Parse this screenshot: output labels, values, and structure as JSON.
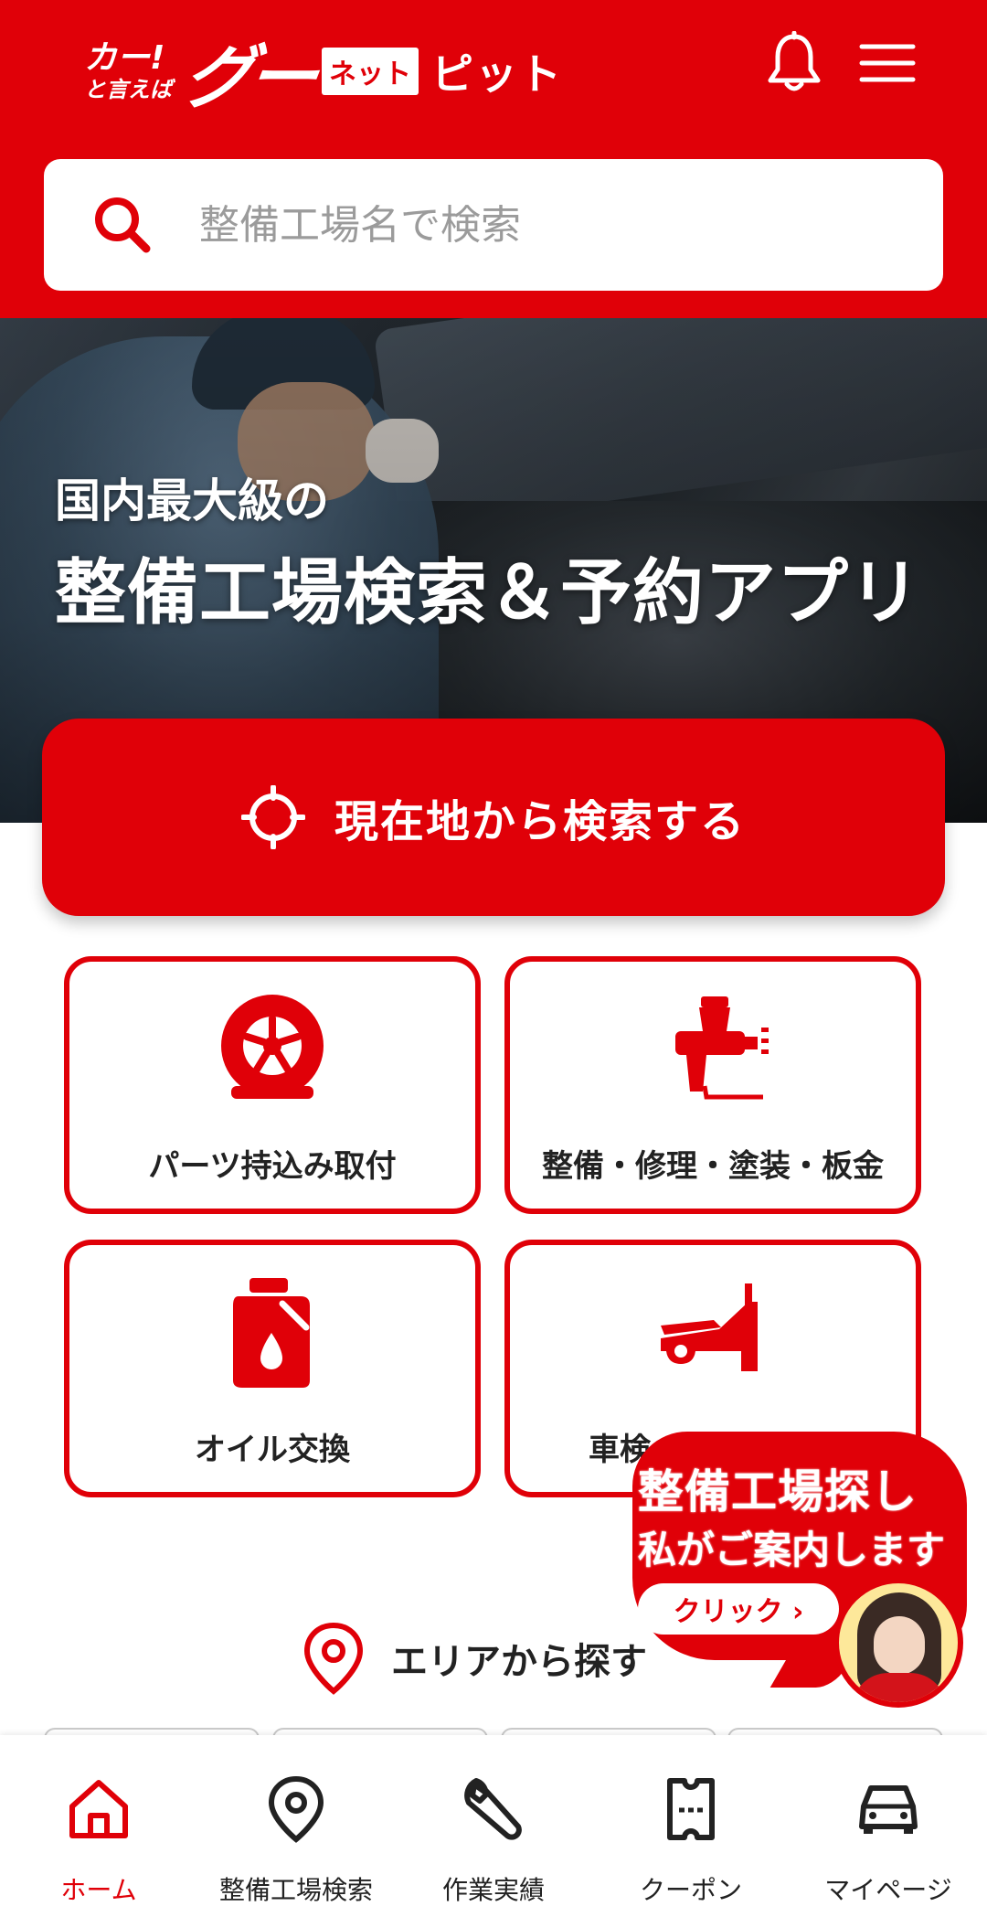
{
  "header": {
    "logo": {
      "tagline_line1": "カー!",
      "tagline_line2": "と言えば",
      "brand": "グー",
      "net": "ネット",
      "product": "ピット"
    },
    "icons": [
      "bell-icon",
      "menu-icon"
    ]
  },
  "search": {
    "placeholder": "整備工場名で検索",
    "icon": "search-icon"
  },
  "hero": {
    "subtitle": "国内最大級の",
    "title": "整備工場検索＆予約アプリ"
  },
  "location_button": {
    "label": "現在地から検索する",
    "icon": "crosshair-icon"
  },
  "categories": [
    {
      "label": "パーツ持込み取付",
      "icon": "tire-icon"
    },
    {
      "label": "整備・修理・塗装・板金",
      "icon": "spray-gun-icon"
    },
    {
      "label": "オイル交換",
      "icon": "oil-can-icon"
    },
    {
      "label": "車検・点検・診断",
      "icon": "car-hood-open-icon"
    }
  ],
  "area_search": {
    "label": "エリアから探す",
    "icon": "map-pin-icon"
  },
  "guide": {
    "line1": "整備工場探し",
    "line2": "私がご案内します",
    "button": "クリック ›"
  },
  "bottom_nav": [
    {
      "label": "ホーム",
      "icon": "home-icon",
      "active": true
    },
    {
      "label": "整備工場検索",
      "icon": "map-pin-icon",
      "active": false
    },
    {
      "label": "作業実績",
      "icon": "wrench-icon",
      "active": false
    },
    {
      "label": "クーポン",
      "icon": "coupon-icon",
      "active": false
    },
    {
      "label": "マイページ",
      "icon": "car-icon",
      "active": false
    }
  ],
  "colors": {
    "brand_red": "#e00008",
    "text": "#222222",
    "placeholder": "#9b9b9b"
  }
}
